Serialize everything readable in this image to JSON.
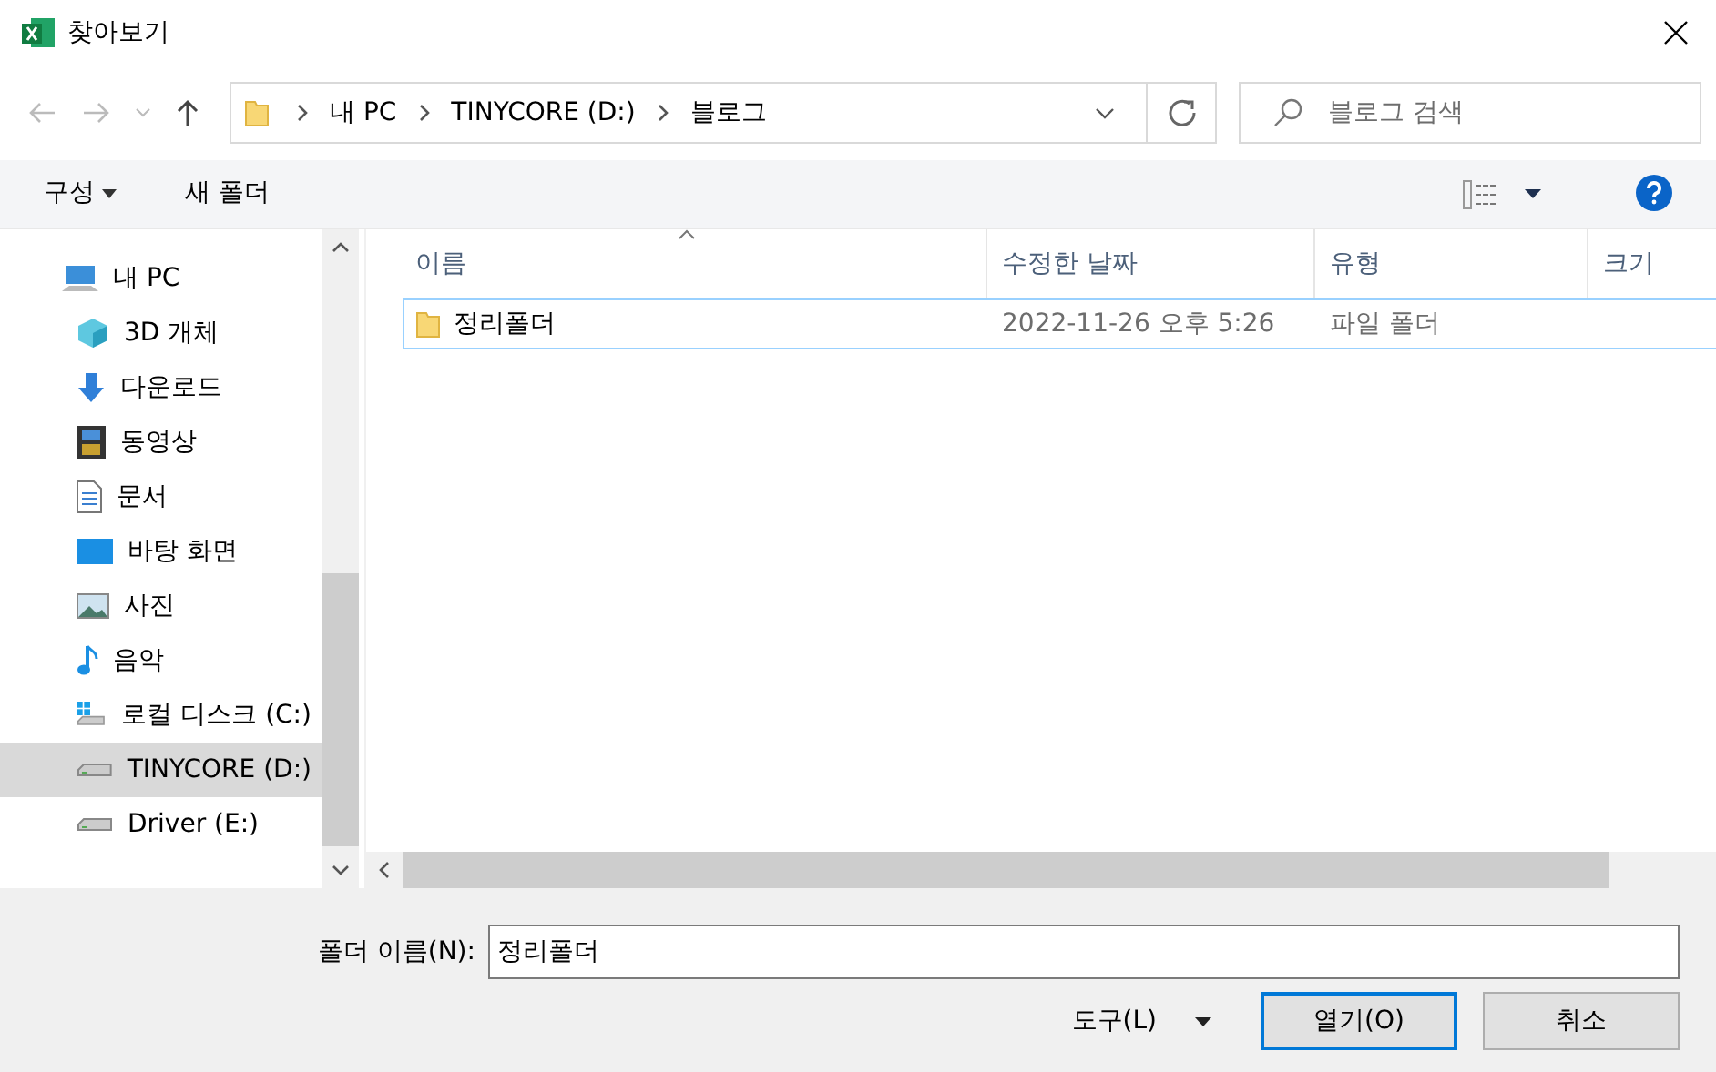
{
  "window": {
    "title": "찾아보기"
  },
  "breadcrumb": [
    "내 PC",
    "TINYCORE (D:)",
    "블로그"
  ],
  "search": {
    "placeholder": "블로그 검색"
  },
  "toolbar": {
    "organize": "구성",
    "new_folder": "새 폴더"
  },
  "sidebar": {
    "items": [
      {
        "label": "내 PC",
        "kind": "pc",
        "selected": false
      },
      {
        "label": "3D 개체",
        "kind": "cube",
        "selected": false
      },
      {
        "label": "다운로드",
        "kind": "download",
        "selected": false
      },
      {
        "label": "동영상",
        "kind": "video",
        "selected": false
      },
      {
        "label": "문서",
        "kind": "document",
        "selected": false
      },
      {
        "label": "바탕 화면",
        "kind": "desktop",
        "selected": false
      },
      {
        "label": "사진",
        "kind": "picture",
        "selected": false
      },
      {
        "label": "음악",
        "kind": "music",
        "selected": false
      },
      {
        "label": "로컬 디스크 (C:)",
        "kind": "windrive",
        "selected": false
      },
      {
        "label": "TINYCORE (D:)",
        "kind": "drive",
        "selected": true
      },
      {
        "label": "Driver (E:)",
        "kind": "drive",
        "selected": false
      }
    ]
  },
  "table": {
    "columns": [
      "이름",
      "수정한 날짜",
      "유형",
      "크기"
    ],
    "rows": [
      {
        "name": "정리폴더",
        "modified": "2022-11-26 오후 5:26",
        "type": "파일 폴더",
        "selected": true
      }
    ]
  },
  "footer": {
    "filename_label": "폴더 이름(N):",
    "filename_value": "정리폴더",
    "tools": "도구(L)",
    "open": "열기(O)",
    "cancel": "취소"
  }
}
